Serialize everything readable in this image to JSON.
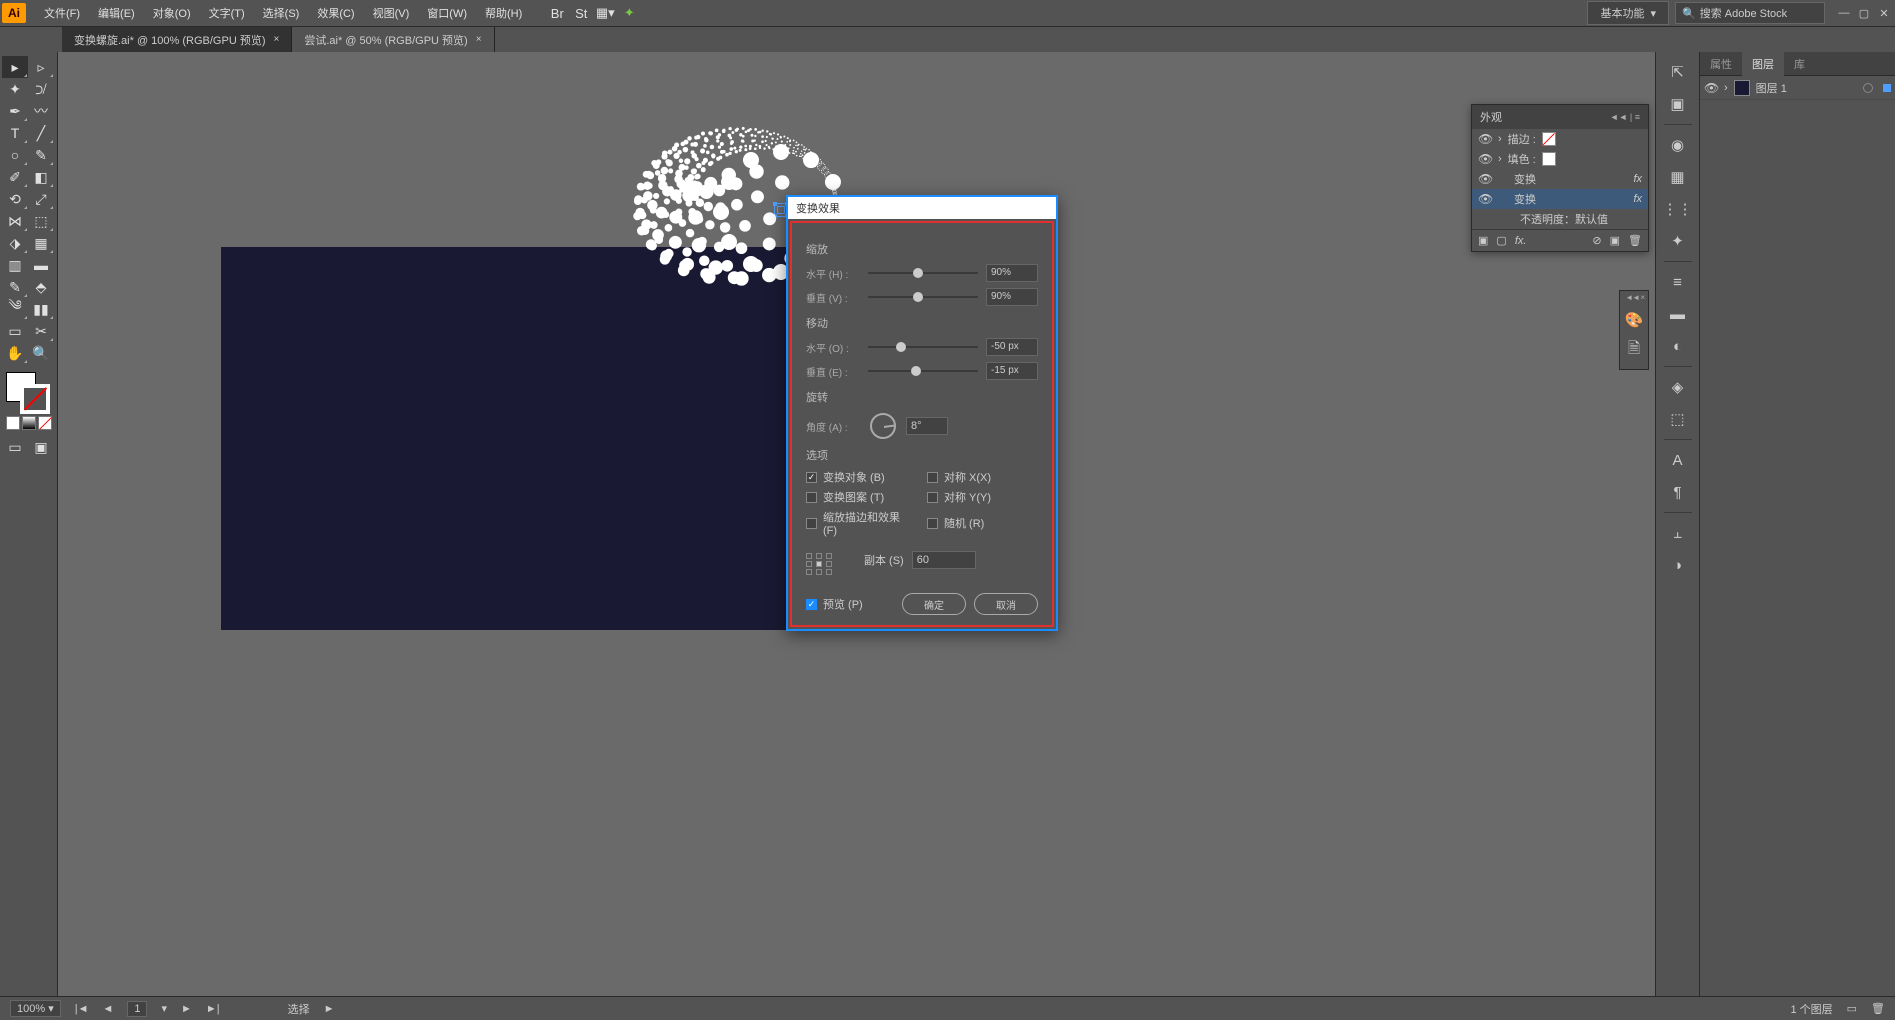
{
  "menu": {
    "items": [
      "文件(F)",
      "编辑(E)",
      "对象(O)",
      "文字(T)",
      "选择(S)",
      "效果(C)",
      "视图(V)",
      "窗口(W)",
      "帮助(H)"
    ],
    "workspace": "基本功能",
    "search_placeholder": "搜索 Adobe Stock"
  },
  "tabs": [
    {
      "label": "变换螺旋.ai* @ 100% (RGB/GPU 预览)",
      "active": true
    },
    {
      "label": "尝试.ai* @ 50% (RGB/GPU 预览)",
      "active": false
    }
  ],
  "panel_tabs": {
    "t1": "属性",
    "t2": "图层",
    "t3": "库"
  },
  "layer": {
    "name": "图层 1"
  },
  "appearance": {
    "title": "外观",
    "rows": [
      {
        "label": "描边 :",
        "swatch": "none"
      },
      {
        "label": "填色 :",
        "swatch": "#fff"
      },
      {
        "label": "变换",
        "fx": true
      },
      {
        "label": "变换",
        "fx": true,
        "sel": true
      },
      {
        "label": "不透明度：默认值",
        "dim": true
      }
    ]
  },
  "dialog": {
    "title": "变换效果",
    "scale": {
      "section": "缩放",
      "h_label": "水平 (H) :",
      "h_val": "90%",
      "v_label": "垂直 (V) :",
      "v_val": "90%"
    },
    "move": {
      "section": "移动",
      "h_label": "水平 (O) :",
      "h_val": "-50 px",
      "v_label": "垂直 (E) :",
      "v_val": "-15 px"
    },
    "rotate": {
      "section": "旋转",
      "a_label": "角度 (A) :",
      "a_val": "8°"
    },
    "options": {
      "section": "选项",
      "transform_obj": "变换对象 (B)",
      "transform_pat": "变换图案 (T)",
      "scale_strokes": "缩放描边和效果 (F)",
      "reflect_x": "对称 X(X)",
      "reflect_y": "对称 Y(Y)",
      "random": "随机 (R)"
    },
    "copies": {
      "label": "副本 (S)",
      "val": "60"
    },
    "preview": "预览 (P)",
    "ok": "确定",
    "cancel": "取消"
  },
  "status": {
    "zoom": "100%",
    "page": "1",
    "tool": "选择",
    "layers_info": "1 个图层"
  }
}
